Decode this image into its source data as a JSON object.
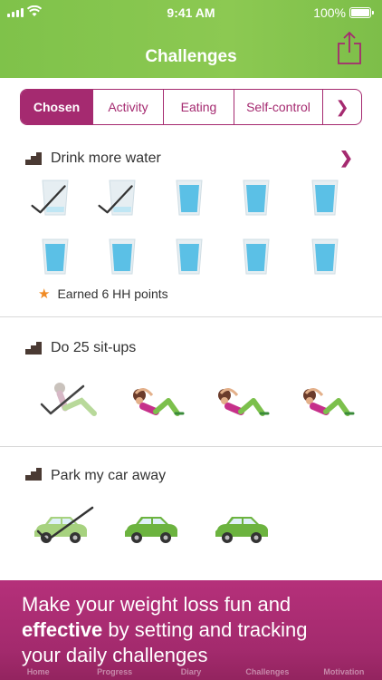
{
  "status": {
    "time": "9:41 AM",
    "battery": "100%"
  },
  "header": {
    "title": "Challenges"
  },
  "tabs": [
    {
      "label": "Chosen",
      "active": true
    },
    {
      "label": "Activity",
      "active": false
    },
    {
      "label": "Eating",
      "active": false
    },
    {
      "label": "Self-control",
      "active": false
    }
  ],
  "sections": [
    {
      "title": "Drink more water",
      "glasses_total": 10,
      "glasses_done": 2,
      "earned": "Earned 6 HH points"
    },
    {
      "title": "Do 25 sit-ups",
      "items_total": 4,
      "items_done": 1
    },
    {
      "title": "Park my car away",
      "items_total": 3,
      "items_done": 1
    }
  ],
  "banner": {
    "line1": "Make your weight loss fun and",
    "bold": "effective",
    "line2_rest": " by setting and tracking",
    "line3": "your daily challenges"
  },
  "navbar": [
    "Home",
    "Progress",
    "Diary",
    "Challenges",
    "Motivation"
  ],
  "colors": {
    "green": "#8cc952",
    "magenta": "#a52a70",
    "water": "#5bc0e6"
  }
}
